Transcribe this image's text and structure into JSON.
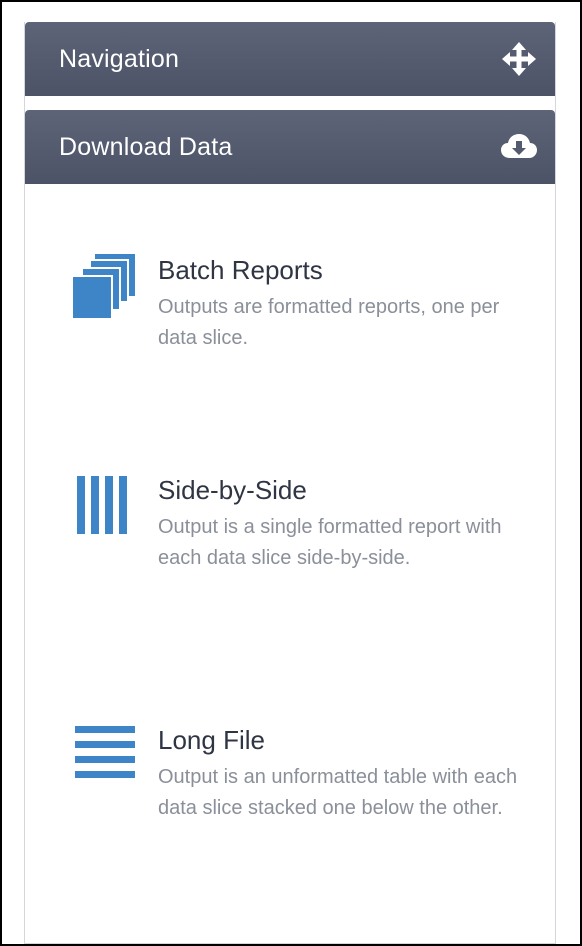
{
  "navigation": {
    "title": "Navigation",
    "icon": "move-arrows-icon"
  },
  "download": {
    "title": "Download Data",
    "icon": "cloud-download-icon",
    "options": [
      {
        "title": "Batch Reports",
        "description": "Outputs are formatted reports, one per data slice.",
        "icon": "stacked-pages-icon"
      },
      {
        "title": "Side-by-Side",
        "description": "Output is a single formatted report with each data slice side-by-side.",
        "icon": "vertical-bars-icon"
      },
      {
        "title": "Long File",
        "description": "Output is an unformatted table with each data slice stacked one below the other.",
        "icon": "horizontal-lines-icon"
      }
    ]
  },
  "colors": {
    "header_bg": "#545b6e",
    "accent_blue": "#3d85c6",
    "title_text": "#2f3542",
    "desc_text": "#8a8f99"
  }
}
